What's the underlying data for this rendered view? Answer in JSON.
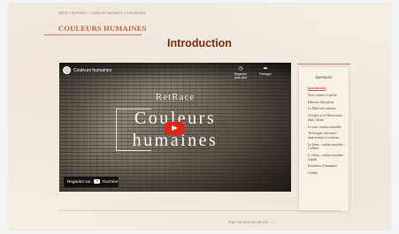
{
  "breadcrumb": "Brind > Épisodes > Couleurs humaines > Introduction",
  "brand": "COULEURS HUMAINES",
  "page_title": "Introduction",
  "video": {
    "title": "Couleurs humaines",
    "watch_later": "Regarder plus tard",
    "share": "Partager",
    "overlay_brand": "RetRace",
    "overlay_line1": "Couleurs",
    "overlay_line2": "humaines",
    "watch_on_label": "Regarder sur",
    "youtube_label": "YouTube"
  },
  "sommaire": {
    "title": "Sommaire",
    "items": [
      {
        "label": "Introduction",
        "active": true
      },
      {
        "label": "Noir comme le péché"
      },
      {
        "label": "Démons éthiopiens"
      },
      {
        "label": "La Bible en couleurs"
      },
      {
        "label": "Al-Jahiz et la Havré noire dans l'islam"
      },
      {
        "label": "Le noir, couleur maudite"
      },
      {
        "label": "Théologies africaines américaines et couleurs"
      },
      {
        "label": "Le blanc, couleur maudite - Gulbeat"
      },
      {
        "label": "Le blanc, couleur maudite - Yakûb"
      },
      {
        "label": "Frontières d'humanité"
      },
      {
        "label": "Crédits"
      }
    ]
  },
  "next_link": "Noir comme le péché →"
}
